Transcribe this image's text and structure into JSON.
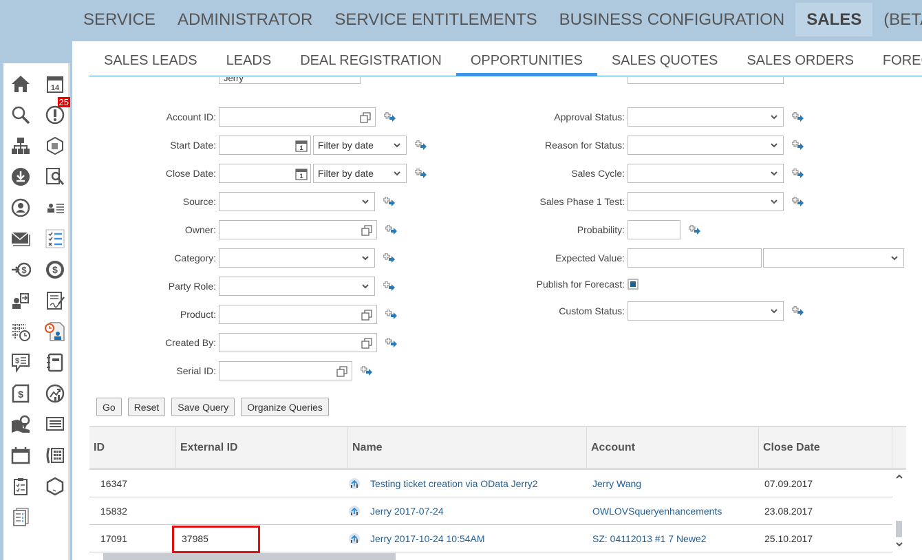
{
  "top_nav": {
    "items": [
      {
        "label": "SERVICE",
        "active": false
      },
      {
        "label": "ADMINISTRATOR",
        "active": false
      },
      {
        "label": "SERVICE ENTITLEMENTS",
        "active": false
      },
      {
        "label": "BUSINESS CONFIGURATION",
        "active": false
      },
      {
        "label": "SALES",
        "active": true
      },
      {
        "label": "(BETA) ADMINISTRATOR",
        "active": false
      }
    ]
  },
  "sub_nav": {
    "items": [
      {
        "label": "SALES LEADS",
        "active": false
      },
      {
        "label": "LEADS",
        "active": false
      },
      {
        "label": "DEAL REGISTRATION",
        "active": false
      },
      {
        "label": "OPPORTUNITIES",
        "active": true
      },
      {
        "label": "SALES QUOTES",
        "active": false
      },
      {
        "label": "SALES ORDERS",
        "active": false
      },
      {
        "label": "FORECASTS",
        "active": false
      }
    ]
  },
  "sidebar": {
    "icons": [
      "home-icon",
      "calendar-icon",
      "search-icon",
      "alert-icon",
      "hierarchy-icon",
      "product-box-icon",
      "download-icon",
      "inspect-icon",
      "contact-icon",
      "team-list-icon",
      "mail-icon",
      "checklist-icon",
      "money-in-icon",
      "dollar-icon",
      "partner-icon",
      "contract-icon",
      "schedule-icon",
      "time-report-icon",
      "quote-icon",
      "notebook-icon",
      "invoice-icon",
      "growth-icon",
      "territory-map-icon",
      "list-icon",
      "appointment-icon",
      "phone-icon",
      "tasks-icon",
      "cube-icon",
      "documents-icon"
    ],
    "alert_badge": "25"
  },
  "form": {
    "top_partial_value": "Jerry",
    "left": [
      {
        "label": "Account ID:",
        "type": "valuehelp",
        "value": ""
      },
      {
        "label": "Start Date:",
        "type": "date",
        "value": "",
        "filter": "Filter by date"
      },
      {
        "label": "Close Date:",
        "type": "date",
        "value": "",
        "filter": "Filter by date"
      },
      {
        "label": "Source:",
        "type": "select",
        "value": ""
      },
      {
        "label": "Owner:",
        "type": "valuehelp",
        "value": ""
      },
      {
        "label": "Category:",
        "type": "select",
        "value": ""
      },
      {
        "label": "Party Role:",
        "type": "select",
        "value": ""
      },
      {
        "label": "Product:",
        "type": "valuehelp",
        "value": ""
      },
      {
        "label": "Created By:",
        "type": "valuehelp",
        "value": ""
      },
      {
        "label": "Serial ID:",
        "type": "valuehelp",
        "value": ""
      }
    ],
    "right": [
      {
        "label": "Approval Status:",
        "type": "select",
        "value": ""
      },
      {
        "label": "Reason for Status:",
        "type": "select",
        "value": ""
      },
      {
        "label": "Sales Cycle:",
        "type": "select",
        "value": ""
      },
      {
        "label": "Sales Phase 1 Test:",
        "type": "select",
        "value": ""
      },
      {
        "label": "Probability:",
        "type": "text",
        "value": ""
      },
      {
        "label": "Expected Value:",
        "type": "amount",
        "value": "",
        "currency": ""
      },
      {
        "label": "Publish for Forecast:",
        "type": "checkbox",
        "checked": true
      },
      {
        "label": "Custom Status:",
        "type": "select",
        "value": ""
      }
    ]
  },
  "buttons": {
    "go": "Go",
    "reset": "Reset",
    "save_query": "Save Query",
    "organize_queries": "Organize Queries"
  },
  "table": {
    "columns": [
      "ID",
      "External ID",
      "Name",
      "Account",
      "Close Date"
    ],
    "rows": [
      {
        "id": "16347",
        "external_id": "",
        "name": "Testing ticket creation via OData Jerry2",
        "account": "Jerry Wang",
        "close_date": "07.09.2017",
        "highlighted": false
      },
      {
        "id": "15832",
        "external_id": "",
        "name": "Jerry 2017-07-24",
        "account": "OWLOVSqueryenhancements",
        "close_date": "23.08.2017",
        "highlighted": false
      },
      {
        "id": "17091",
        "external_id": "37985",
        "name": "Jerry 2017-10-24 10:54AM",
        "account": "SZ: 04112013 #1 7 Newe2",
        "close_date": "25.10.2017",
        "highlighted": true
      }
    ]
  },
  "colors": {
    "header_bg": "#aec8de",
    "accent": "#3a95ee",
    "link": "#1f5f96",
    "highlight": "#e01010"
  }
}
